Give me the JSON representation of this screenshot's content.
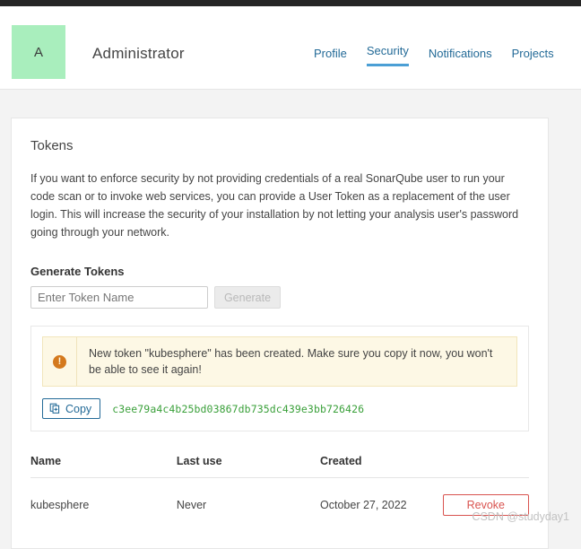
{
  "header": {
    "avatar_initial": "A",
    "user_name": "Administrator",
    "nav": [
      {
        "label": "Profile",
        "active": false
      },
      {
        "label": "Security",
        "active": true
      },
      {
        "label": "Notifications",
        "active": false
      },
      {
        "label": "Projects",
        "active": false
      }
    ]
  },
  "card": {
    "title": "Tokens",
    "intro": "If you want to enforce security by not providing credentials of a real SonarQube user to run your code scan or to invoke web services, you can provide a User Token as a replacement of the user login. This will increase the security of your installation by not letting your analysis user's password going through your network.",
    "generate": {
      "section_title": "Generate Tokens",
      "input_placeholder": "Enter Token Name",
      "input_value": "",
      "button_label": "Generate",
      "button_disabled": "true"
    },
    "alert": {
      "icon": "warning-circle-icon",
      "message": "New token \"kubesphere\" has been created. Make sure you copy it now, you won't be able to see it again!",
      "copy_button_label": "Copy",
      "copy_icon": "copy-icon",
      "token_value": "c3ee79a4c4b25bd03867db735dc439e3bb726426"
    },
    "table": {
      "columns": [
        "Name",
        "Last use",
        "Created",
        ""
      ],
      "rows": [
        {
          "name": "kubesphere",
          "last_use": "Never",
          "created": "October 27, 2022",
          "action_label": "Revoke"
        }
      ]
    }
  },
  "watermark": "CSDN @studyday1",
  "colors": {
    "topbar": "#262626",
    "avatar_bg": "#a9eebd",
    "link": "#236a97",
    "tab_underline": "#4b9fd5",
    "alert_bg": "#fdf8e5",
    "alert_border": "#f2e5bc",
    "warn_icon": "#d4791d",
    "token_text": "#3aa03a",
    "revoke": "#d9534f",
    "page_bg": "#f3f3f3"
  }
}
